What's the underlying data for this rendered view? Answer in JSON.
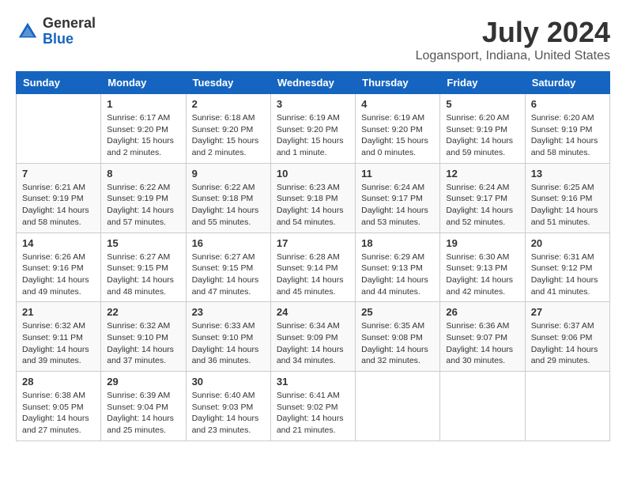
{
  "header": {
    "logo_line1": "General",
    "logo_line2": "Blue",
    "main_title": "July 2024",
    "subtitle": "Logansport, Indiana, United States"
  },
  "calendar": {
    "days_of_week": [
      "Sunday",
      "Monday",
      "Tuesday",
      "Wednesday",
      "Thursday",
      "Friday",
      "Saturday"
    ],
    "weeks": [
      [
        {
          "day": "",
          "info": ""
        },
        {
          "day": "1",
          "info": "Sunrise: 6:17 AM\nSunset: 9:20 PM\nDaylight: 15 hours\nand 2 minutes."
        },
        {
          "day": "2",
          "info": "Sunrise: 6:18 AM\nSunset: 9:20 PM\nDaylight: 15 hours\nand 2 minutes."
        },
        {
          "day": "3",
          "info": "Sunrise: 6:19 AM\nSunset: 9:20 PM\nDaylight: 15 hours\nand 1 minute."
        },
        {
          "day": "4",
          "info": "Sunrise: 6:19 AM\nSunset: 9:20 PM\nDaylight: 15 hours\nand 0 minutes."
        },
        {
          "day": "5",
          "info": "Sunrise: 6:20 AM\nSunset: 9:19 PM\nDaylight: 14 hours\nand 59 minutes."
        },
        {
          "day": "6",
          "info": "Sunrise: 6:20 AM\nSunset: 9:19 PM\nDaylight: 14 hours\nand 58 minutes."
        }
      ],
      [
        {
          "day": "7",
          "info": "Sunrise: 6:21 AM\nSunset: 9:19 PM\nDaylight: 14 hours\nand 58 minutes."
        },
        {
          "day": "8",
          "info": "Sunrise: 6:22 AM\nSunset: 9:19 PM\nDaylight: 14 hours\nand 57 minutes."
        },
        {
          "day": "9",
          "info": "Sunrise: 6:22 AM\nSunset: 9:18 PM\nDaylight: 14 hours\nand 55 minutes."
        },
        {
          "day": "10",
          "info": "Sunrise: 6:23 AM\nSunset: 9:18 PM\nDaylight: 14 hours\nand 54 minutes."
        },
        {
          "day": "11",
          "info": "Sunrise: 6:24 AM\nSunset: 9:17 PM\nDaylight: 14 hours\nand 53 minutes."
        },
        {
          "day": "12",
          "info": "Sunrise: 6:24 AM\nSunset: 9:17 PM\nDaylight: 14 hours\nand 52 minutes."
        },
        {
          "day": "13",
          "info": "Sunrise: 6:25 AM\nSunset: 9:16 PM\nDaylight: 14 hours\nand 51 minutes."
        }
      ],
      [
        {
          "day": "14",
          "info": "Sunrise: 6:26 AM\nSunset: 9:16 PM\nDaylight: 14 hours\nand 49 minutes."
        },
        {
          "day": "15",
          "info": "Sunrise: 6:27 AM\nSunset: 9:15 PM\nDaylight: 14 hours\nand 48 minutes."
        },
        {
          "day": "16",
          "info": "Sunrise: 6:27 AM\nSunset: 9:15 PM\nDaylight: 14 hours\nand 47 minutes."
        },
        {
          "day": "17",
          "info": "Sunrise: 6:28 AM\nSunset: 9:14 PM\nDaylight: 14 hours\nand 45 minutes."
        },
        {
          "day": "18",
          "info": "Sunrise: 6:29 AM\nSunset: 9:13 PM\nDaylight: 14 hours\nand 44 minutes."
        },
        {
          "day": "19",
          "info": "Sunrise: 6:30 AM\nSunset: 9:13 PM\nDaylight: 14 hours\nand 42 minutes."
        },
        {
          "day": "20",
          "info": "Sunrise: 6:31 AM\nSunset: 9:12 PM\nDaylight: 14 hours\nand 41 minutes."
        }
      ],
      [
        {
          "day": "21",
          "info": "Sunrise: 6:32 AM\nSunset: 9:11 PM\nDaylight: 14 hours\nand 39 minutes."
        },
        {
          "day": "22",
          "info": "Sunrise: 6:32 AM\nSunset: 9:10 PM\nDaylight: 14 hours\nand 37 minutes."
        },
        {
          "day": "23",
          "info": "Sunrise: 6:33 AM\nSunset: 9:10 PM\nDaylight: 14 hours\nand 36 minutes."
        },
        {
          "day": "24",
          "info": "Sunrise: 6:34 AM\nSunset: 9:09 PM\nDaylight: 14 hours\nand 34 minutes."
        },
        {
          "day": "25",
          "info": "Sunrise: 6:35 AM\nSunset: 9:08 PM\nDaylight: 14 hours\nand 32 minutes."
        },
        {
          "day": "26",
          "info": "Sunrise: 6:36 AM\nSunset: 9:07 PM\nDaylight: 14 hours\nand 30 minutes."
        },
        {
          "day": "27",
          "info": "Sunrise: 6:37 AM\nSunset: 9:06 PM\nDaylight: 14 hours\nand 29 minutes."
        }
      ],
      [
        {
          "day": "28",
          "info": "Sunrise: 6:38 AM\nSunset: 9:05 PM\nDaylight: 14 hours\nand 27 minutes."
        },
        {
          "day": "29",
          "info": "Sunrise: 6:39 AM\nSunset: 9:04 PM\nDaylight: 14 hours\nand 25 minutes."
        },
        {
          "day": "30",
          "info": "Sunrise: 6:40 AM\nSunset: 9:03 PM\nDaylight: 14 hours\nand 23 minutes."
        },
        {
          "day": "31",
          "info": "Sunrise: 6:41 AM\nSunset: 9:02 PM\nDaylight: 14 hours\nand 21 minutes."
        },
        {
          "day": "",
          "info": ""
        },
        {
          "day": "",
          "info": ""
        },
        {
          "day": "",
          "info": ""
        }
      ]
    ]
  }
}
